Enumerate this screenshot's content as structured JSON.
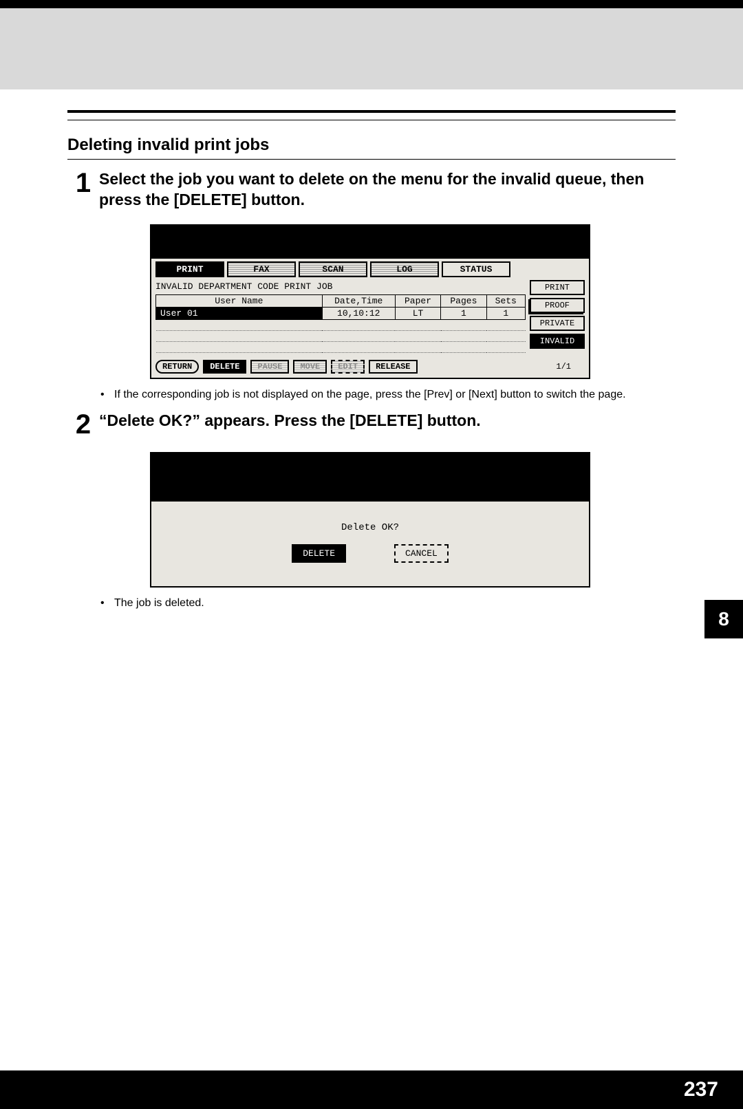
{
  "header": {
    "section_title": "Deleting invalid print jobs"
  },
  "steps": {
    "step1": {
      "num": "1",
      "text": "Select the job you want to delete on the menu for the invalid queue, then press the [DELETE] button.",
      "note": "If the corresponding job is not displayed on the page, press the [Prev] or [Next] button to switch the page."
    },
    "step2": {
      "num": "2",
      "text": "“Delete OK?” appears. Press the [DELETE] button.",
      "note": "The job is deleted."
    }
  },
  "lcd1": {
    "tabs": [
      "PRINT",
      "FAX",
      "SCAN",
      "LOG",
      "STATUS"
    ],
    "subtitle": "INVALID DEPARTMENT CODE PRINT JOB",
    "table": {
      "headers": [
        "User Name",
        "Date,Time",
        "Paper",
        "Pages",
        "Sets"
      ],
      "row": {
        "user": "User 01",
        "datetime": "10,10:12",
        "paper": "LT",
        "pages": "1",
        "sets": "1"
      }
    },
    "side": [
      "PRINT",
      "PROOF",
      "PRIVATE",
      "INVALID"
    ],
    "bottom": {
      "return": "RETURN",
      "delete": "DELETE",
      "pause": "PAUSE",
      "move": "MOVE",
      "edit": "EDIT",
      "release": "RELEASE",
      "page": "1/1"
    }
  },
  "lcd2": {
    "message": "Delete OK?",
    "delete": "DELETE",
    "cancel": "CANCEL"
  },
  "chapter": "8",
  "page_number": "237"
}
